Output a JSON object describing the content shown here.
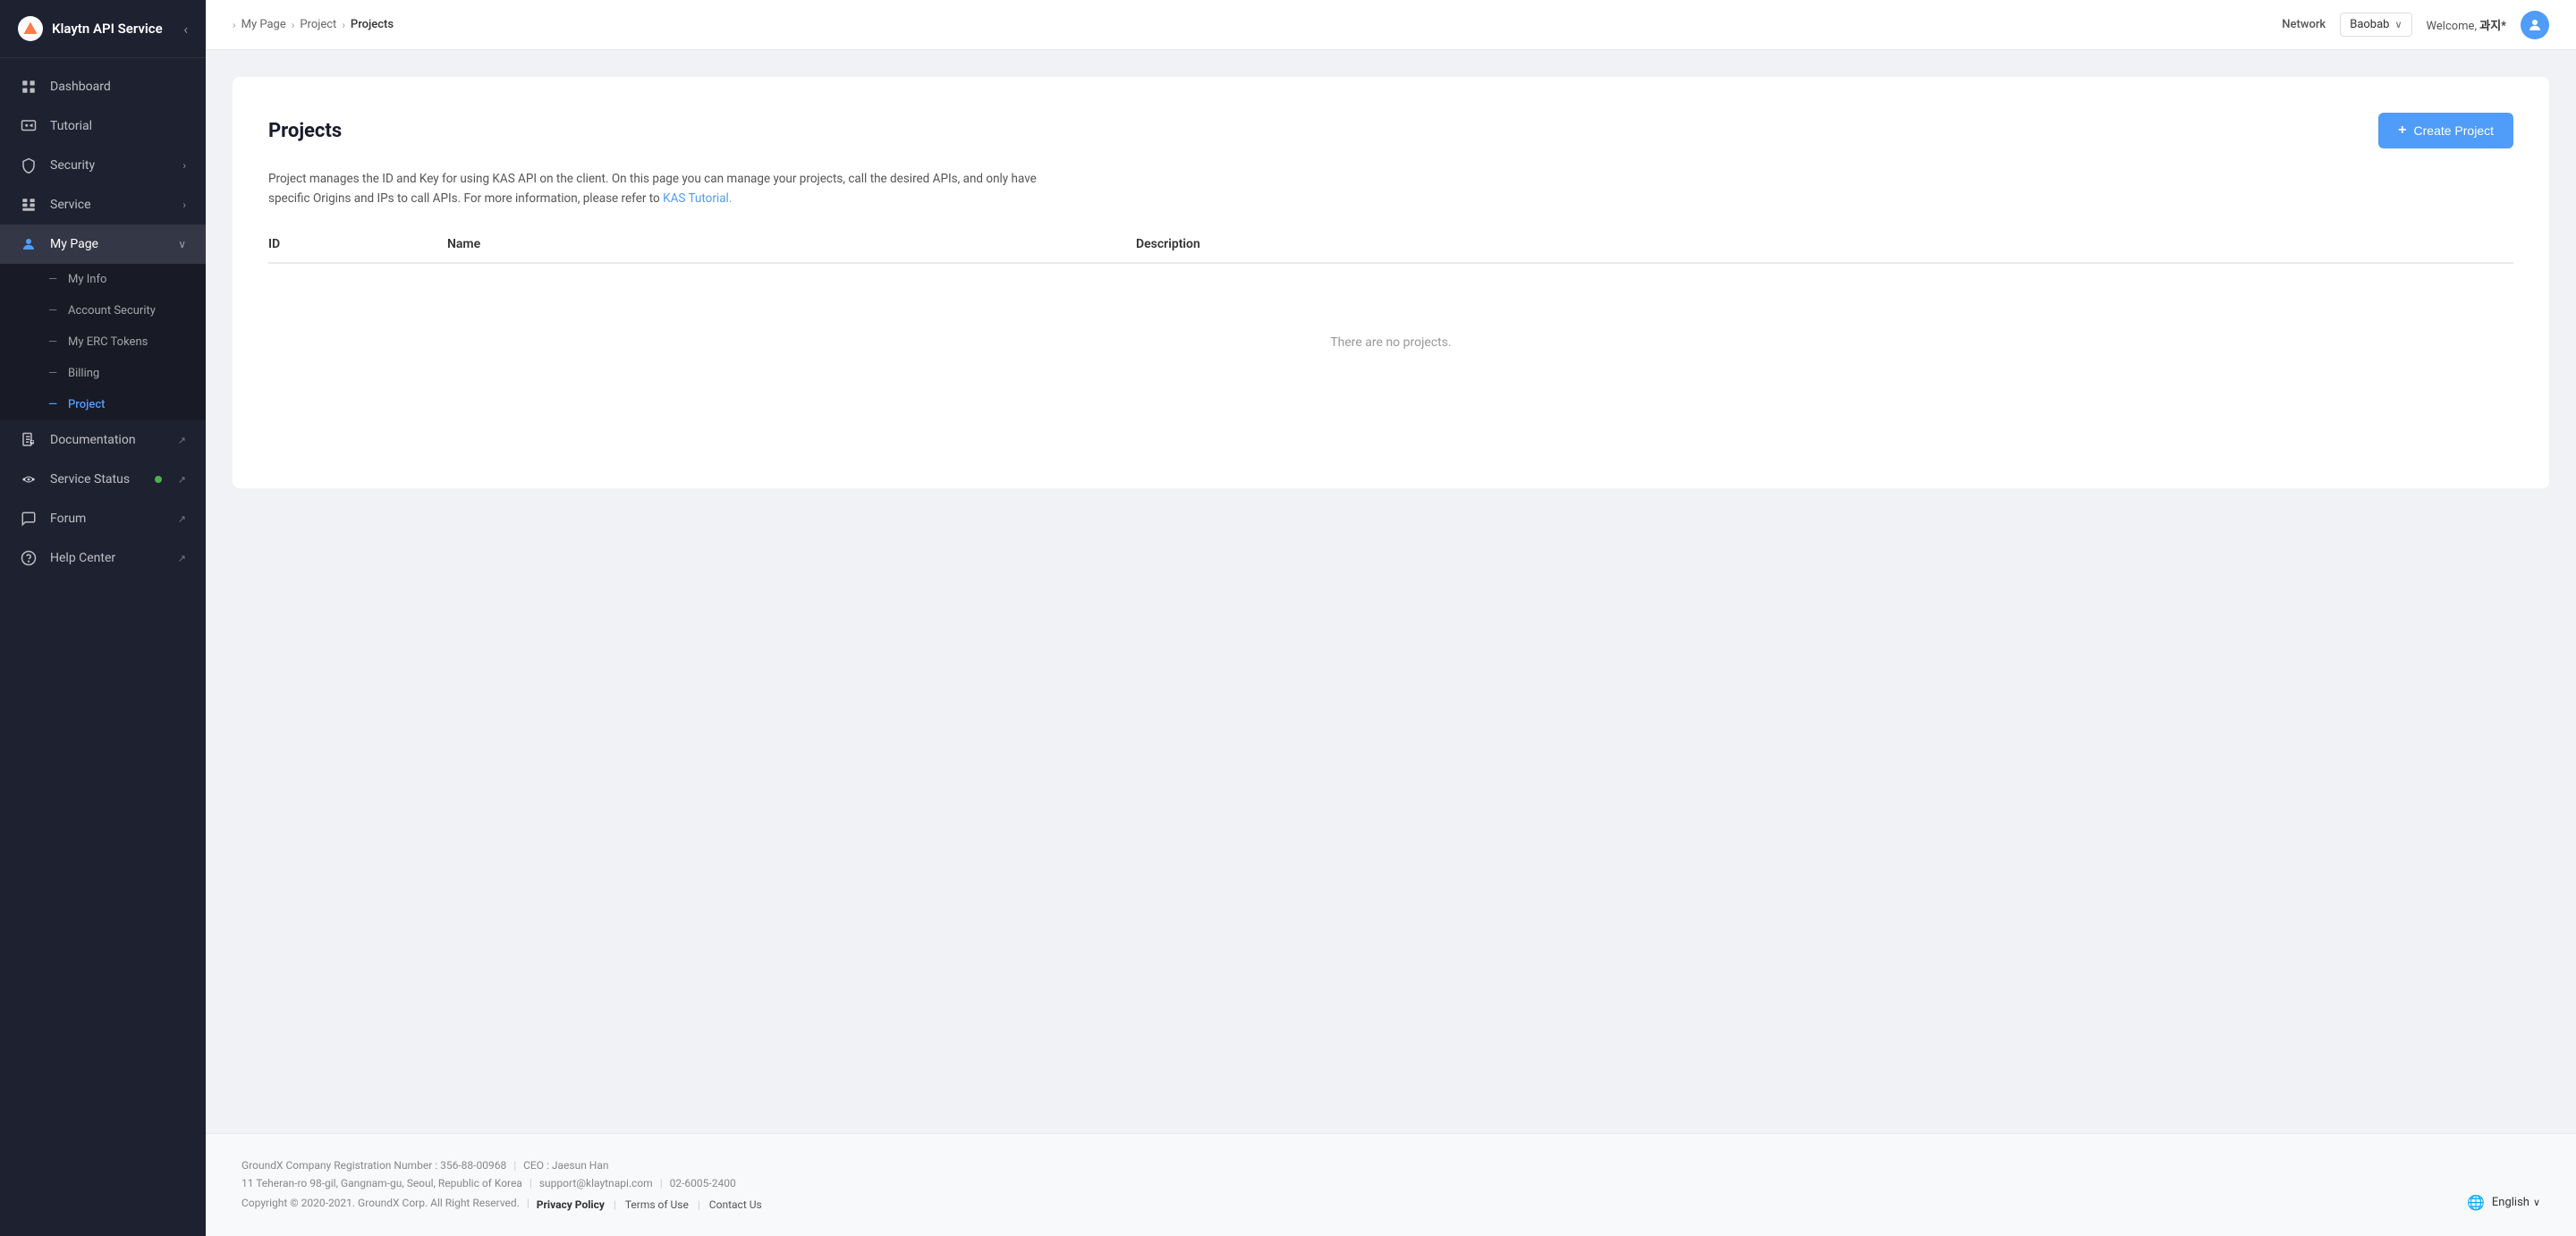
{
  "app": {
    "logo_text": "Klaytn API Service",
    "collapse_icon": "‹"
  },
  "sidebar": {
    "items": [
      {
        "id": "dashboard",
        "label": "Dashboard",
        "icon": "dashboard",
        "active": false,
        "expandable": false
      },
      {
        "id": "tutorial",
        "label": "Tutorial",
        "icon": "tutorial",
        "active": false,
        "expandable": false
      },
      {
        "id": "security",
        "label": "Security",
        "icon": "security",
        "active": false,
        "expandable": true
      },
      {
        "id": "service",
        "label": "Service",
        "icon": "service",
        "active": false,
        "expandable": true
      },
      {
        "id": "mypage",
        "label": "My Page",
        "icon": "mypage",
        "active": true,
        "expandable": true,
        "expanded": true
      },
      {
        "id": "documentation",
        "label": "Documentation",
        "icon": "documentation",
        "active": false,
        "external": true
      },
      {
        "id": "service-status",
        "label": "Service Status",
        "icon": "service-status",
        "active": false,
        "external": true,
        "has_dot": true
      },
      {
        "id": "forum",
        "label": "Forum",
        "icon": "forum",
        "active": false,
        "external": true
      },
      {
        "id": "help-center",
        "label": "Help Center",
        "icon": "help-center",
        "active": false,
        "external": true
      }
    ],
    "sub_items": [
      {
        "id": "my-info",
        "label": "My Info",
        "active": false
      },
      {
        "id": "account-security",
        "label": "Account Security",
        "active": false
      },
      {
        "id": "my-erc-tokens",
        "label": "My ERC Tokens",
        "active": false
      },
      {
        "id": "billing",
        "label": "Billing",
        "active": false
      },
      {
        "id": "project",
        "label": "Project",
        "active": true
      }
    ]
  },
  "topbar": {
    "breadcrumbs": [
      {
        "label": "My Page",
        "active": false
      },
      {
        "label": "Project",
        "active": false
      },
      {
        "label": "Projects",
        "active": true
      }
    ],
    "network_label": "Network",
    "network_value": "Baobab",
    "welcome_prefix": "Welcome, ",
    "welcome_name": "과지*"
  },
  "projects": {
    "title": "Projects",
    "create_button": "+ Create Project",
    "description": "Project manages the ID and Key for using KAS API on the client. On this page you can manage your projects, call the desired APIs, and only have specific Origins and IPs to call APIs. For more information, please refer to ",
    "description_link": "KAS Tutorial.",
    "description_link_href": "#",
    "table_headers": {
      "id": "ID",
      "name": "Name",
      "description": "Description"
    },
    "empty_message": "There are no projects."
  },
  "footer": {
    "company_reg": "GroundX Company Registration Number : 356-88-00968",
    "ceo": "CEO : Jaesun Han",
    "address": "11 Teheran-ro 98-gil, Gangnam-gu, Seoul, Republic of Korea",
    "email": "support@klaytnapi.com",
    "phone": "02-6005-2400",
    "copyright": "Copyright © 2020-2021. GroundX Corp. All Right Reserved.",
    "links": [
      {
        "label": "Privacy Policy",
        "bold": true
      },
      {
        "label": "Terms of Use",
        "bold": false
      },
      {
        "label": "Contact Us",
        "bold": false
      }
    ],
    "language": "English"
  }
}
